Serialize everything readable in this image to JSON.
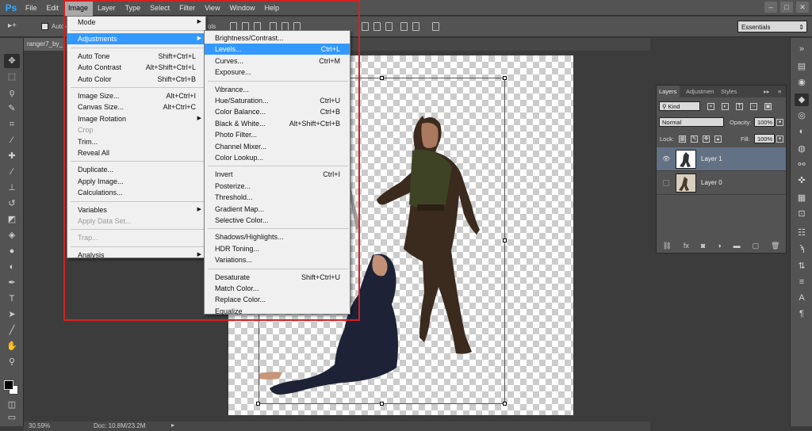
{
  "app": {
    "logo": "Ps"
  },
  "menubar": [
    "File",
    "Edit",
    "Image",
    "Layer",
    "Type",
    "Select",
    "Filter",
    "View",
    "Window",
    "Help"
  ],
  "window_controls": [
    "–",
    "□",
    "✕"
  ],
  "options": {
    "auto_label": "Auto-",
    "workspace": "Essentials",
    "partial_text": "ols"
  },
  "document": {
    "tab_title": "ranger7_by_"
  },
  "image_menu": [
    {
      "label": "Mode",
      "shortcut": "",
      "submenu": true,
      "state": "normal"
    },
    {
      "sep": true
    },
    {
      "label": "Adjustments",
      "shortcut": "",
      "submenu": true,
      "state": "highlighted"
    },
    {
      "sep": true
    },
    {
      "label": "Auto Tone",
      "shortcut": "Shift+Ctrl+L",
      "state": "normal"
    },
    {
      "label": "Auto Contrast",
      "shortcut": "Alt+Shift+Ctrl+L",
      "state": "normal"
    },
    {
      "label": "Auto Color",
      "shortcut": "Shift+Ctrl+B",
      "state": "normal"
    },
    {
      "sep": true
    },
    {
      "label": "Image Size...",
      "shortcut": "Alt+Ctrl+I",
      "state": "normal"
    },
    {
      "label": "Canvas Size...",
      "shortcut": "Alt+Ctrl+C",
      "state": "normal"
    },
    {
      "label": "Image Rotation",
      "shortcut": "",
      "submenu": true,
      "state": "normal"
    },
    {
      "label": "Crop",
      "shortcut": "",
      "state": "disabled"
    },
    {
      "label": "Trim...",
      "shortcut": "",
      "state": "normal"
    },
    {
      "label": "Reveal All",
      "shortcut": "",
      "state": "normal"
    },
    {
      "sep": true
    },
    {
      "label": "Duplicate...",
      "shortcut": "",
      "state": "normal"
    },
    {
      "label": "Apply Image...",
      "shortcut": "",
      "state": "normal"
    },
    {
      "label": "Calculations...",
      "shortcut": "",
      "state": "normal"
    },
    {
      "sep": true
    },
    {
      "label": "Variables",
      "shortcut": "",
      "submenu": true,
      "state": "normal"
    },
    {
      "label": "Apply Data Set...",
      "shortcut": "",
      "state": "disabled"
    },
    {
      "sep": true
    },
    {
      "label": "Trap...",
      "shortcut": "",
      "state": "disabled"
    },
    {
      "sep": true
    },
    {
      "label": "Analysis",
      "shortcut": "",
      "submenu": true,
      "state": "normal"
    }
  ],
  "adjustments_menu": [
    {
      "label": "Brightness/Contrast...",
      "shortcut": "",
      "state": "normal"
    },
    {
      "label": "Levels...",
      "shortcut": "Ctrl+L",
      "state": "highlighted"
    },
    {
      "label": "Curves...",
      "shortcut": "Ctrl+M",
      "state": "normal"
    },
    {
      "label": "Exposure...",
      "shortcut": "",
      "state": "normal"
    },
    {
      "sep": true
    },
    {
      "label": "Vibrance...",
      "shortcut": "",
      "state": "normal"
    },
    {
      "label": "Hue/Saturation...",
      "shortcut": "Ctrl+U",
      "state": "normal"
    },
    {
      "label": "Color Balance...",
      "shortcut": "Ctrl+B",
      "state": "normal"
    },
    {
      "label": "Black & White...",
      "shortcut": "Alt+Shift+Ctrl+B",
      "state": "normal"
    },
    {
      "label": "Photo Filter...",
      "shortcut": "",
      "state": "normal"
    },
    {
      "label": "Channel Mixer...",
      "shortcut": "",
      "state": "normal"
    },
    {
      "label": "Color Lookup...",
      "shortcut": "",
      "state": "normal"
    },
    {
      "sep": true
    },
    {
      "label": "Invert",
      "shortcut": "Ctrl+I",
      "state": "normal"
    },
    {
      "label": "Posterize...",
      "shortcut": "",
      "state": "normal"
    },
    {
      "label": "Threshold...",
      "shortcut": "",
      "state": "normal"
    },
    {
      "label": "Gradient Map...",
      "shortcut": "",
      "state": "normal"
    },
    {
      "label": "Selective Color...",
      "shortcut": "",
      "state": "normal"
    },
    {
      "sep": true
    },
    {
      "label": "Shadows/Highlights...",
      "shortcut": "",
      "state": "normal"
    },
    {
      "label": "HDR Toning...",
      "shortcut": "",
      "state": "normal"
    },
    {
      "label": "Variations...",
      "shortcut": "",
      "state": "normal"
    },
    {
      "sep": true
    },
    {
      "label": "Desaturate",
      "shortcut": "Shift+Ctrl+U",
      "state": "normal"
    },
    {
      "label": "Match Color...",
      "shortcut": "",
      "state": "normal"
    },
    {
      "label": "Replace Color...",
      "shortcut": "",
      "state": "normal"
    },
    {
      "label": "Equalize",
      "shortcut": "",
      "state": "normal"
    }
  ],
  "layers_panel": {
    "tabs": [
      "Layers",
      "Adjustmen",
      "Styles"
    ],
    "filter_kind": "Kind",
    "blend_mode": "Normal",
    "opacity_label": "Opacity:",
    "opacity_value": "100%",
    "lock_label": "Lock:",
    "fill_label": "Fill:",
    "fill_value": "100%",
    "layers": [
      {
        "name": "Layer 1",
        "visible": true,
        "selected": true
      },
      {
        "name": "Layer 0",
        "visible": false,
        "selected": false
      }
    ]
  },
  "status": {
    "zoom": "30.59%",
    "doc_size": "Doc: 10.8M/23.2M"
  },
  "colors": {
    "highlight": "#3399ff",
    "annotation_box": "#d62020",
    "selected_layer": "#627184"
  }
}
